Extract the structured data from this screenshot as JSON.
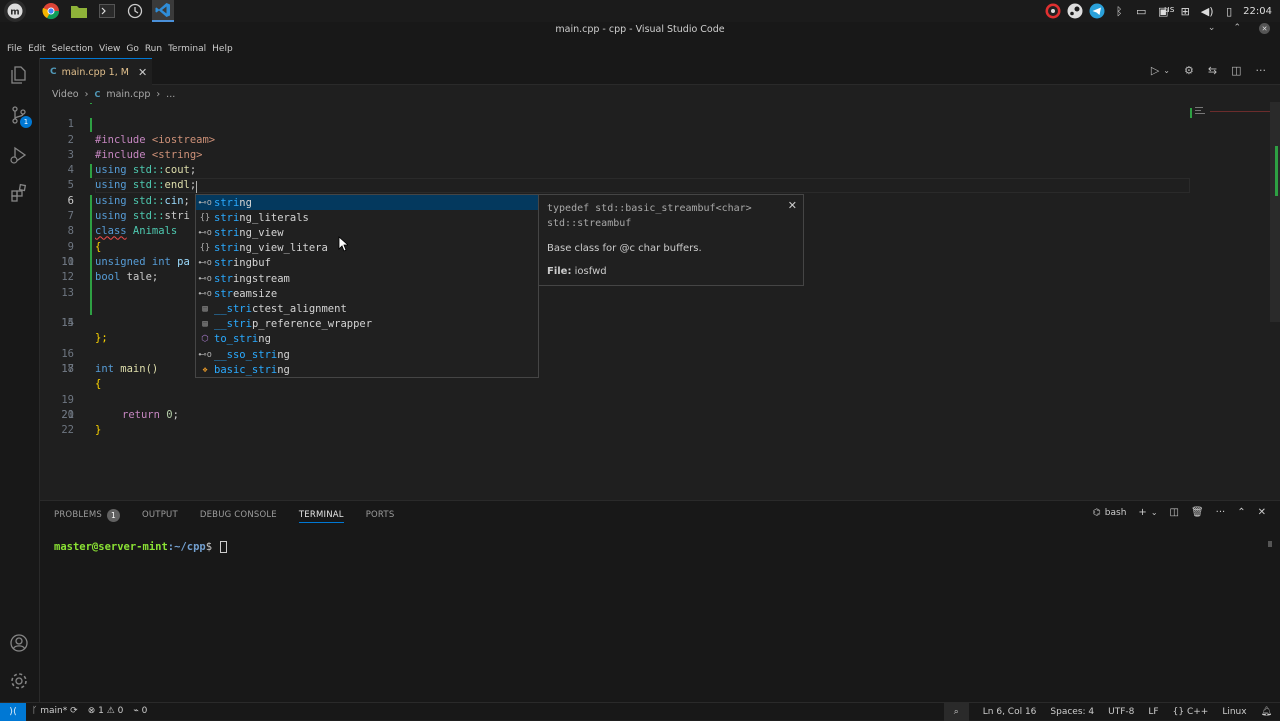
{
  "os": {
    "clock": "22:04",
    "keyboard_layout": "us",
    "launcher_icons": [
      "mint-menu-icon",
      "chrome-icon",
      "files-icon",
      "terminal-icon",
      "timeshift-icon",
      "vscode-icon"
    ]
  },
  "window": {
    "title": "main.cpp - cpp - Visual Studio Code"
  },
  "menu": [
    "File",
    "Edit",
    "Selection",
    "View",
    "Go",
    "Run",
    "Terminal",
    "Help"
  ],
  "activity_bar": {
    "scm_badge": "1"
  },
  "tab": {
    "file_icon": "C",
    "label": "main.cpp 1, M",
    "close": "✕"
  },
  "breadcrumb": {
    "folder": "Video",
    "sep": "›",
    "file_icon": "C",
    "file": "main.cpp",
    "sep2": "›",
    "more": "..."
  },
  "editor": {
    "line_numbers": [
      "1",
      "2",
      "3",
      "4",
      "5",
      "6",
      "7",
      "8",
      "9",
      "10",
      "11",
      "12",
      "13",
      "14",
      "15",
      "16",
      "17",
      "18",
      "19",
      "20",
      "21",
      "22"
    ],
    "current_line": "6",
    "lines": {
      "l1_a": "#include",
      "l1_b": " <iostream>",
      "l2_a": "#include",
      "l2_b": " <string>",
      "l3_a": "using",
      "l3_b": " std::",
      "l3_c": "cout",
      "l3_d": ";",
      "l4_a": "using",
      "l4_b": " std::",
      "l4_c": "endl",
      "l4_d": ";",
      "l5_a": "using",
      "l5_b": " std::",
      "l5_c": "cin",
      "l5_d": ";",
      "l6_a": "using",
      "l6_b": " std::",
      "l6_c": "stri",
      "l7_a": "class",
      "l7_b": " Animals",
      "l8": "{",
      "l9_a": "unsigned int",
      "l9_b": " pa",
      "l10_a": "bool",
      "l10_b": " tale;",
      "l14": "};",
      "l16_a": "int",
      "l16_b": " main()",
      "l17": "{",
      "l19_a": "return",
      "l19_b": " 0",
      "l19_c": ";",
      "l20": "}"
    }
  },
  "suggestions": [
    {
      "icon": "⊷o",
      "match": "stri",
      "rest": "ng",
      "selected": true
    },
    {
      "icon": "{}",
      "match": "stri",
      "rest": "ng_literals",
      "selected": false
    },
    {
      "icon": "⊷o",
      "match": "stri",
      "rest": "ng_view",
      "selected": false
    },
    {
      "icon": "{}",
      "match": "stri",
      "rest": "ng_view_litera",
      "selected": false
    },
    {
      "icon": "⊷o",
      "match": "str",
      "rest": "ingbuf",
      "selected": false
    },
    {
      "icon": "⊷o",
      "match": "str",
      "rest": "ingstream",
      "selected": false
    },
    {
      "icon": "⊷o",
      "match": "str",
      "rest": "eamsize",
      "selected": false
    },
    {
      "icon": "▤",
      "match": "__stri",
      "rest": "ctest_alignment",
      "selected": false
    },
    {
      "icon": "▤",
      "match": "__stri",
      "rest": "p_reference_wrapper",
      "selected": false
    },
    {
      "icon": "⬡",
      "match": "to_stri",
      "rest": "ng",
      "selected": false
    },
    {
      "icon": "⊷o",
      "match": "__sso_stri",
      "rest": "ng",
      "selected": false
    },
    {
      "icon": "❖",
      "match": "basic_stri",
      "rest": "ng",
      "selected": false
    }
  ],
  "suggest_doc": {
    "signature": "typedef std::basic_streambuf<char>\nstd::streambuf",
    "close": "✕",
    "description": "Base class for @c char buffers.",
    "file_label": "File:",
    "file_value": " iosfwd"
  },
  "panel": {
    "tabs": [
      {
        "label": "PROBLEMS",
        "badge": "1"
      },
      {
        "label": "OUTPUT"
      },
      {
        "label": "DEBUG CONSOLE"
      },
      {
        "label": "TERMINAL",
        "active": true
      },
      {
        "label": "PORTS"
      }
    ],
    "shell": "bash",
    "prompt_user": "master@server-mint",
    "prompt_path": ":~/cpp",
    "prompt_end": "$ "
  },
  "status": {
    "remote": "⟩⟨",
    "branch": "main*",
    "sync": "⟳",
    "errors": "1",
    "warnings": "0",
    "ports": "0",
    "cursor_pos": "Ln 6, Col 16",
    "spaces": "Spaces: 4",
    "encoding": "UTF-8",
    "eol": "LF",
    "language": "C++",
    "platform": "Linux"
  },
  "colors": {
    "accent": "#0078d4",
    "keyword": "#569cd6",
    "include": "#c586c0",
    "match_highlight": "#2aaaff"
  }
}
